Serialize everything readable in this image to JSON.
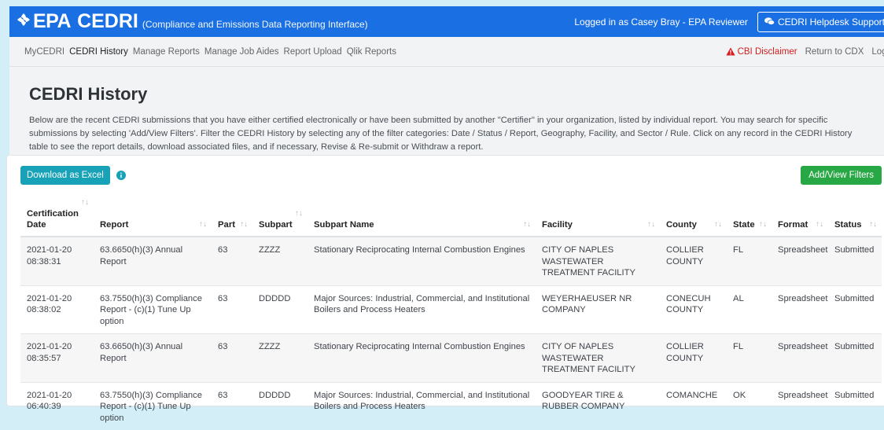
{
  "header": {
    "brand_epa": "EPA",
    "brand_cedri": "CEDRI",
    "brand_subtitle": "(Compliance and Emissions Data Reporting Interface)",
    "logged_in": "Logged in as Casey Bray - EPA Reviewer",
    "helpdesk_label": "CEDRI Helpdesk Support"
  },
  "nav": {
    "items": [
      "MyCEDRI",
      "CEDRI History",
      "Manage Reports",
      "Manage Job Aides",
      "Report Upload",
      "Qlik Reports"
    ],
    "cbi_label": "CBI Disclaimer",
    "return_label": "Return to CDX",
    "logout_label": "Logo"
  },
  "page": {
    "title": "CEDRI History",
    "intro": "Below are the recent CEDRI submissions that you have either certified electronically or have been submitted by another \"Certifier\" in your organization, listed by individual report. You may search for specific submissions by selecting 'Add/View Filters'. Filter the CEDRI History by selecting any of the filter categories: Date / Status / Report, Geography, Facility, and Sector / Rule. Click on any record in the CEDRI History table to see the report details, download associated files, and if necessary, Revise & Re-submit or Withdraw a report."
  },
  "toolbar": {
    "excel_label": "Download as Excel",
    "filters_label": "Add/View Filters"
  },
  "table": {
    "columns": [
      "Certification Date",
      "Report",
      "Part",
      "Subpart",
      "Subpart Name",
      "Facility",
      "County",
      "State",
      "Format",
      "Status"
    ],
    "rows": [
      [
        "2021-01-20 08:38:31",
        "63.6650(h)(3) Annual Report",
        "63",
        "ZZZZ",
        "Stationary Reciprocating Internal Combustion Engines",
        "CITY OF NAPLES WASTEWATER TREATMENT FACILITY",
        "COLLIER COUNTY",
        "FL",
        "Spreadsheet",
        "Submitted"
      ],
      [
        "2021-01-20 08:38:02",
        "63.7550(h)(3) Compliance Report - (c)(1) Tune Up option",
        "63",
        "DDDDD",
        "Major Sources: Industrial, Commercial, and Institutional Boilers and Process Heaters",
        "WEYERHAEUSER NR COMPANY",
        "CONECUH COUNTY",
        "AL",
        "Spreadsheet",
        "Submitted"
      ],
      [
        "2021-01-20 08:35:57",
        "63.6650(h)(3) Annual Report",
        "63",
        "ZZZZ",
        "Stationary Reciprocating Internal Combustion Engines",
        "CITY OF NAPLES WASTEWATER TREATMENT FACILITY",
        "COLLIER COUNTY",
        "FL",
        "Spreadsheet",
        "Submitted"
      ],
      [
        "2021-01-20 06:40:39",
        "63.7550(h)(3) Compliance Report - (c)(1) Tune Up option",
        "63",
        "DDDDD",
        "Major Sources: Industrial, Commercial, and Institutional Boilers and Process Heaters",
        "GOODYEAR TIRE & RUBBER COMPANY",
        "COMANCHE",
        "OK",
        "Spreadsheet",
        "Submitted"
      ]
    ]
  },
  "colors": {
    "topbar": "#1a6fe3",
    "excel_button": "#17a2b8",
    "filters_button": "#28a745",
    "cbi": "#d21f1f"
  }
}
